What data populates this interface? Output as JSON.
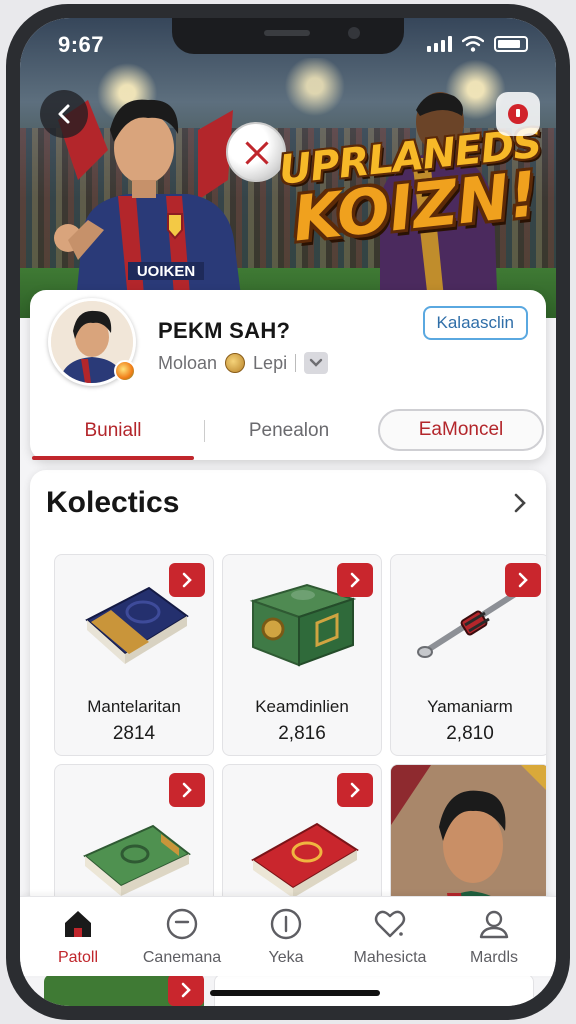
{
  "status_bar": {
    "time": "9:67"
  },
  "hero": {
    "game_title_line1": "UPRLANEDS",
    "game_title_line2": "KOIZN!",
    "jersey_text": "UOIKEN"
  },
  "profile": {
    "name": "PEKM SAH?",
    "meta_label": "Moloan",
    "meta_value": "Lepi",
    "follow_label": "Kalaasclin"
  },
  "tabs": [
    {
      "label": "Buniall",
      "active": true
    },
    {
      "label": "Penealon",
      "active": false
    },
    {
      "label": "EaMoncel",
      "active": false
    }
  ],
  "collection": {
    "title": "Kolectics",
    "items": [
      {
        "name": "Mantelaritan",
        "number": "2814",
        "icon": "blue-book-icon"
      },
      {
        "name": "Keamdinlien",
        "number": "2,816",
        "icon": "green-chest-icon"
      },
      {
        "name": "Yamaniarm",
        "number": "2,810",
        "icon": "tool-icon"
      },
      {
        "name": "",
        "number": "",
        "icon": "green-book-icon"
      },
      {
        "name": "",
        "number": "",
        "icon": "red-book-icon"
      },
      {
        "name": "",
        "number": "",
        "icon": "player-portrait"
      }
    ]
  },
  "bottom_nav": [
    {
      "label": "Patoll",
      "icon": "home-icon",
      "active": true
    },
    {
      "label": "Canemana",
      "icon": "minus-circle-icon",
      "active": false
    },
    {
      "label": "Yeka",
      "icon": "info-circle-icon",
      "active": false
    },
    {
      "label": "Mahesicta",
      "icon": "heart-icon",
      "active": false
    },
    {
      "label": "Mardls",
      "icon": "profile-icon",
      "active": false
    }
  ],
  "colors": {
    "accent": "#c0262c",
    "link": "#2f6ea8",
    "title_gold": "#f0a11e"
  }
}
